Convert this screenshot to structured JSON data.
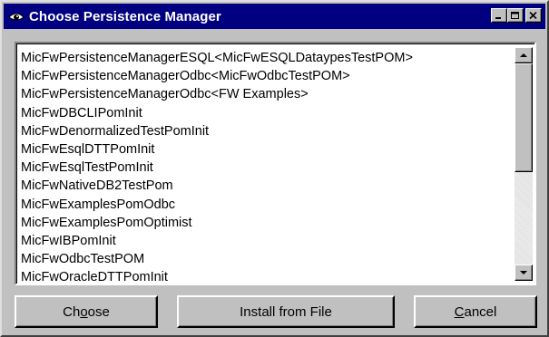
{
  "window": {
    "title": "Choose Persistence Manager",
    "icon": "eye-app-icon",
    "controls": [
      "minimize-icon",
      "maximize-icon",
      "close-icon"
    ]
  },
  "list": {
    "items": [
      "MicFwPersistenceManagerESQL<MicFwESQLDataypesTestPOM>",
      "MicFwPersistenceManagerOdbc<MicFwOdbcTestPOM>",
      "MicFwPersistenceManagerOdbc<FW Examples>",
      "MicFwDBCLIPomInit",
      "MicFwDenormalizedTestPomInit",
      "MicFwEsqlDTTPomInit",
      "MicFwEsqlTestPomInit",
      "MicFwNativeDB2TestPom",
      "MicFwExamplesPomOdbc",
      "MicFwExamplesPomOptimist",
      "MicFwIBPomInit",
      "MicFwOdbcTestPOM",
      "MicFwOracleDTTPomInit"
    ]
  },
  "buttons": {
    "choose": {
      "pre": "Ch",
      "mnemonic": "o",
      "post": "ose"
    },
    "install": {
      "label": "Install from File"
    },
    "cancel": {
      "pre": "",
      "mnemonic": "C",
      "post": "ancel"
    }
  },
  "colors": {
    "titlebar": "#000080",
    "face": "#c0c0c0"
  }
}
